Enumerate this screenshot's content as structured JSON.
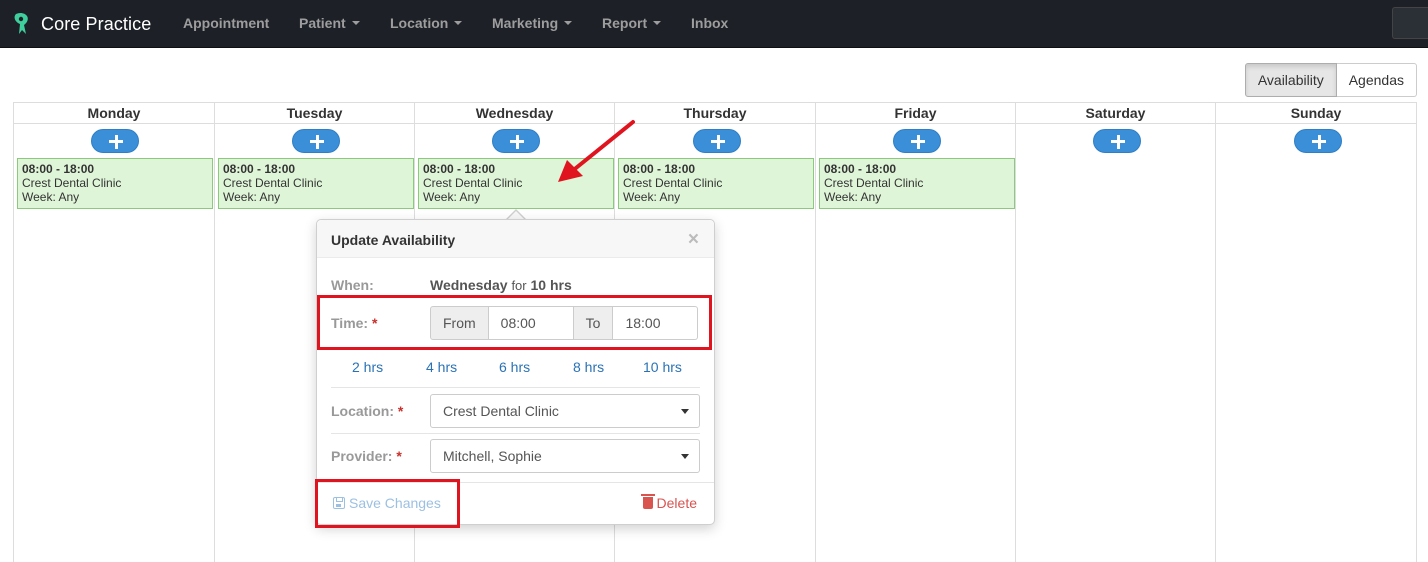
{
  "brand": {
    "name": "Core Practice",
    "logo_icon": "tooth-icon"
  },
  "nav": {
    "items": [
      {
        "label": "Appointment",
        "dropdown": false
      },
      {
        "label": "Patient",
        "dropdown": true
      },
      {
        "label": "Location",
        "dropdown": true
      },
      {
        "label": "Marketing",
        "dropdown": true
      },
      {
        "label": "Report",
        "dropdown": true
      },
      {
        "label": "Inbox",
        "dropdown": false
      }
    ]
  },
  "view_toggle": {
    "availability": "Availability",
    "agendas": "Agendas",
    "active": "Availability"
  },
  "calendar": {
    "days": [
      {
        "name": "Monday",
        "slot": {
          "time": "08:00 - 18:00",
          "location": "Crest Dental Clinic",
          "week": "Week: Any"
        }
      },
      {
        "name": "Tuesday",
        "slot": {
          "time": "08:00 - 18:00",
          "location": "Crest Dental Clinic",
          "week": "Week: Any"
        }
      },
      {
        "name": "Wednesday",
        "slot": {
          "time": "08:00 - 18:00",
          "location": "Crest Dental Clinic",
          "week": "Week: Any"
        }
      },
      {
        "name": "Thursday",
        "slot": {
          "time": "08:00 - 18:00",
          "location": "Crest Dental Clinic",
          "week": "Week: Any"
        }
      },
      {
        "name": "Friday",
        "slot": {
          "time": "08:00 - 18:00",
          "location": "Crest Dental Clinic",
          "week": "Week: Any"
        }
      },
      {
        "name": "Saturday",
        "slot": null
      },
      {
        "name": "Sunday",
        "slot": null
      }
    ]
  },
  "popover": {
    "title": "Update Availability",
    "close_glyph": "×",
    "when_label": "When:",
    "when_day": "Wednesday",
    "when_for": "for",
    "when_duration": "10 hrs",
    "time_label": "Time:",
    "required_mark": "*",
    "from_label": "From",
    "from_value": "08:00",
    "to_label": "To",
    "to_value": "18:00",
    "quick_durations": [
      "2 hrs",
      "4 hrs",
      "6 hrs",
      "8 hrs",
      "10 hrs"
    ],
    "location_label": "Location:",
    "location_value": "Crest Dental Clinic",
    "provider_label": "Provider:",
    "provider_value": "Mitchell, Sophie",
    "save_label": "Save Changes",
    "delete_label": "Delete"
  },
  "colors": {
    "navbar_bg": "#1d2127",
    "add_button": "#3a8fd8",
    "slot_bg": "#dff5d8",
    "slot_border": "#8cc97e",
    "annotation_red": "#e0141e",
    "delete_red": "#d9534f",
    "link_blue": "#2a72b5"
  }
}
